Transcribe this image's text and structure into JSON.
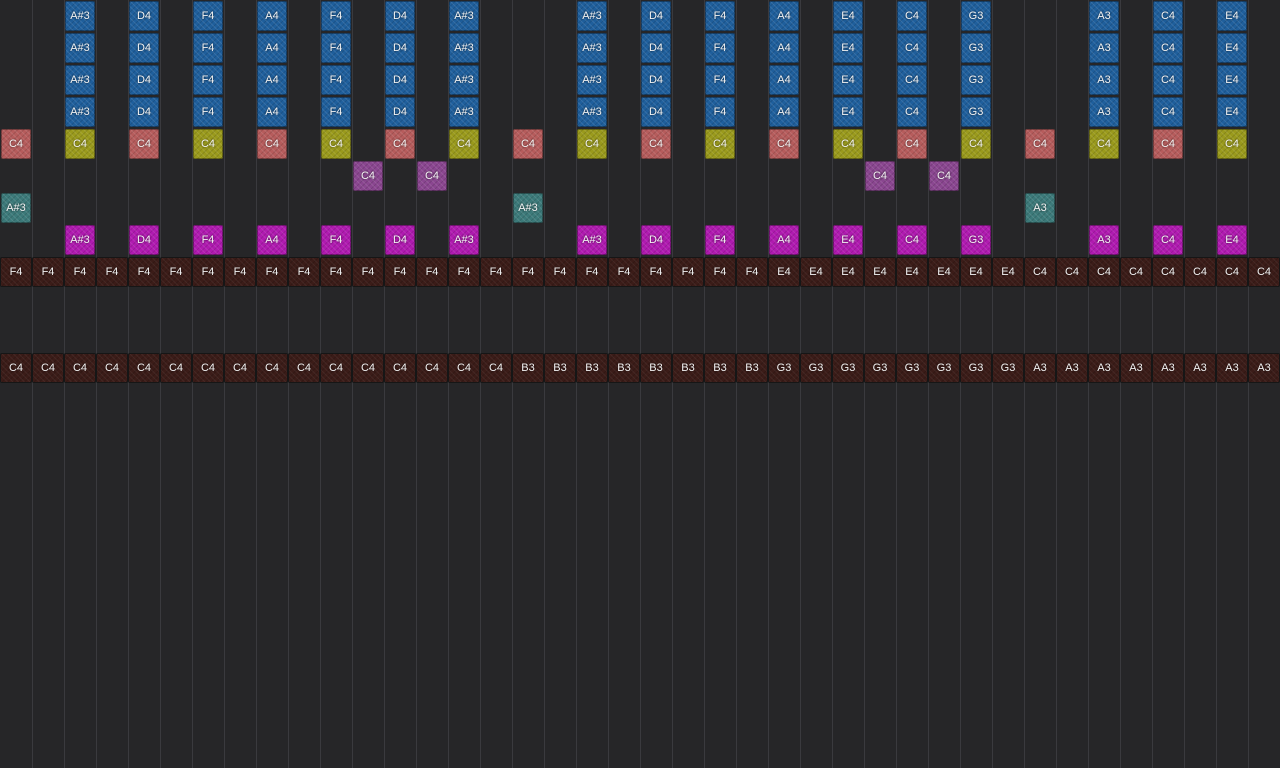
{
  "palette": {
    "background": "#262628",
    "grid_line": "#3a3a3e",
    "blue": "#1f5f9c",
    "salmon": "#b65c5c",
    "olive": "#9a9a1c",
    "purple": "#8a4690",
    "teal": "#3c7a7a",
    "magenta": "#b01ab0",
    "bass": "#3b1c18"
  },
  "columns": 40,
  "rows": [
    {
      "name": "lead-row-1",
      "style": "blue",
      "cells": [
        "",
        "",
        "A#3",
        "",
        "D4",
        "",
        "F4",
        "",
        "A4",
        "",
        "F4",
        "",
        "D4",
        "",
        "A#3",
        "",
        "",
        "",
        "A#3",
        "",
        "D4",
        "",
        "F4",
        "",
        "A4",
        "",
        "E4",
        "",
        "C4",
        "",
        "G3",
        "",
        "",
        "",
        "A3",
        "",
        "C4",
        "",
        "E4",
        ""
      ]
    },
    {
      "name": "lead-row-2",
      "style": "blue",
      "cells": [
        "",
        "",
        "A#3",
        "",
        "D4",
        "",
        "F4",
        "",
        "A4",
        "",
        "F4",
        "",
        "D4",
        "",
        "A#3",
        "",
        "",
        "",
        "A#3",
        "",
        "D4",
        "",
        "F4",
        "",
        "A4",
        "",
        "E4",
        "",
        "C4",
        "",
        "G3",
        "",
        "",
        "",
        "A3",
        "",
        "C4",
        "",
        "E4",
        ""
      ]
    },
    {
      "name": "lead-row-3",
      "style": "blue",
      "cells": [
        "",
        "",
        "A#3",
        "",
        "D4",
        "",
        "F4",
        "",
        "A4",
        "",
        "F4",
        "",
        "D4",
        "",
        "A#3",
        "",
        "",
        "",
        "A#3",
        "",
        "D4",
        "",
        "F4",
        "",
        "A4",
        "",
        "E4",
        "",
        "C4",
        "",
        "G3",
        "",
        "",
        "",
        "A3",
        "",
        "C4",
        "",
        "E4",
        ""
      ]
    },
    {
      "name": "lead-row-4",
      "style": "blue",
      "cells": [
        "",
        "",
        "A#3",
        "",
        "D4",
        "",
        "F4",
        "",
        "A4",
        "",
        "F4",
        "",
        "D4",
        "",
        "A#3",
        "",
        "",
        "",
        "A#3",
        "",
        "D4",
        "",
        "F4",
        "",
        "A4",
        "",
        "E4",
        "",
        "C4",
        "",
        "G3",
        "",
        "",
        "",
        "A3",
        "",
        "C4",
        "",
        "E4",
        ""
      ]
    },
    {
      "name": "chord-row",
      "style": "mixed",
      "cells": [
        "C4",
        "",
        "C4",
        "",
        "C4",
        "",
        "C4",
        "",
        "C4",
        "",
        "C4",
        "",
        "C4",
        "",
        "C4",
        "",
        "C4",
        "",
        "C4",
        "",
        "C4",
        "",
        "C4",
        "",
        "C4",
        "",
        "C4",
        "",
        "C4",
        "",
        "C4",
        "",
        "C4",
        "",
        "C4",
        "",
        "C4",
        "",
        "C4",
        ""
      ],
      "styles": [
        "salmon",
        "",
        "olive",
        "",
        "salmon",
        "",
        "olive",
        "",
        "salmon",
        "",
        "olive",
        "",
        "salmon",
        "",
        "olive",
        "",
        "salmon",
        "",
        "olive",
        "",
        "salmon",
        "",
        "olive",
        "",
        "salmon",
        "",
        "olive",
        "",
        "salmon",
        "",
        "olive",
        "",
        "salmon",
        "",
        "olive",
        "",
        "salmon",
        "",
        "olive",
        ""
      ]
    },
    {
      "name": "accent-row",
      "style": "purple",
      "cells": [
        "",
        "",
        "",
        "",
        "",
        "",
        "",
        "",
        "",
        "",
        "",
        "C4",
        "",
        "C4",
        "",
        "",
        "",
        "",
        "",
        "",
        "",
        "",
        "",
        "",
        "",
        "",
        "",
        "C4",
        "",
        "C4",
        "",
        "",
        "",
        "",
        "",
        "",
        "",
        "",
        "",
        ""
      ]
    },
    {
      "name": "root-row",
      "style": "teal",
      "cells": [
        "A#3",
        "",
        "",
        "",
        "",
        "",
        "",
        "",
        "",
        "",
        "",
        "",
        "",
        "",
        "",
        "",
        "A#3",
        "",
        "",
        "",
        "",
        "",
        "",
        "",
        "",
        "",
        "",
        "",
        "",
        "",
        "",
        "",
        "A3",
        "",
        "",
        "",
        "",
        "",
        "",
        ""
      ]
    },
    {
      "name": "arp-row",
      "style": "magenta",
      "cells": [
        "",
        "",
        "A#3",
        "",
        "D4",
        "",
        "F4",
        "",
        "A4",
        "",
        "F4",
        "",
        "D4",
        "",
        "A#3",
        "",
        "",
        "",
        "A#3",
        "",
        "D4",
        "",
        "F4",
        "",
        "A4",
        "",
        "E4",
        "",
        "C4",
        "",
        "G3",
        "",
        "",
        "",
        "A3",
        "",
        "C4",
        "",
        "E4",
        ""
      ]
    },
    {
      "name": "bass-row-1",
      "style": "bass",
      "cells": [
        "F4",
        "F4",
        "F4",
        "F4",
        "F4",
        "F4",
        "F4",
        "F4",
        "F4",
        "F4",
        "F4",
        "F4",
        "F4",
        "F4",
        "F4",
        "F4",
        "F4",
        "F4",
        "F4",
        "F4",
        "F4",
        "F4",
        "F4",
        "F4",
        "E4",
        "E4",
        "E4",
        "E4",
        "E4",
        "E4",
        "E4",
        "E4",
        "C4",
        "C4",
        "C4",
        "C4",
        "C4",
        "C4",
        "C4",
        "C4"
      ]
    },
    {
      "name": "empty-row-1",
      "style": "",
      "cells": []
    },
    {
      "name": "empty-row-2",
      "style": "",
      "cells": []
    },
    {
      "name": "bass-row-2",
      "style": "bass",
      "cells": [
        "C4",
        "C4",
        "C4",
        "C4",
        "C4",
        "C4",
        "C4",
        "C4",
        "C4",
        "C4",
        "C4",
        "C4",
        "C4",
        "C4",
        "C4",
        "C4",
        "B3",
        "B3",
        "B3",
        "B3",
        "B3",
        "B3",
        "B3",
        "B3",
        "G3",
        "G3",
        "G3",
        "G3",
        "G3",
        "G3",
        "G3",
        "G3",
        "A3",
        "A3",
        "A3",
        "A3",
        "A3",
        "A3",
        "A3",
        "A3"
      ]
    }
  ]
}
